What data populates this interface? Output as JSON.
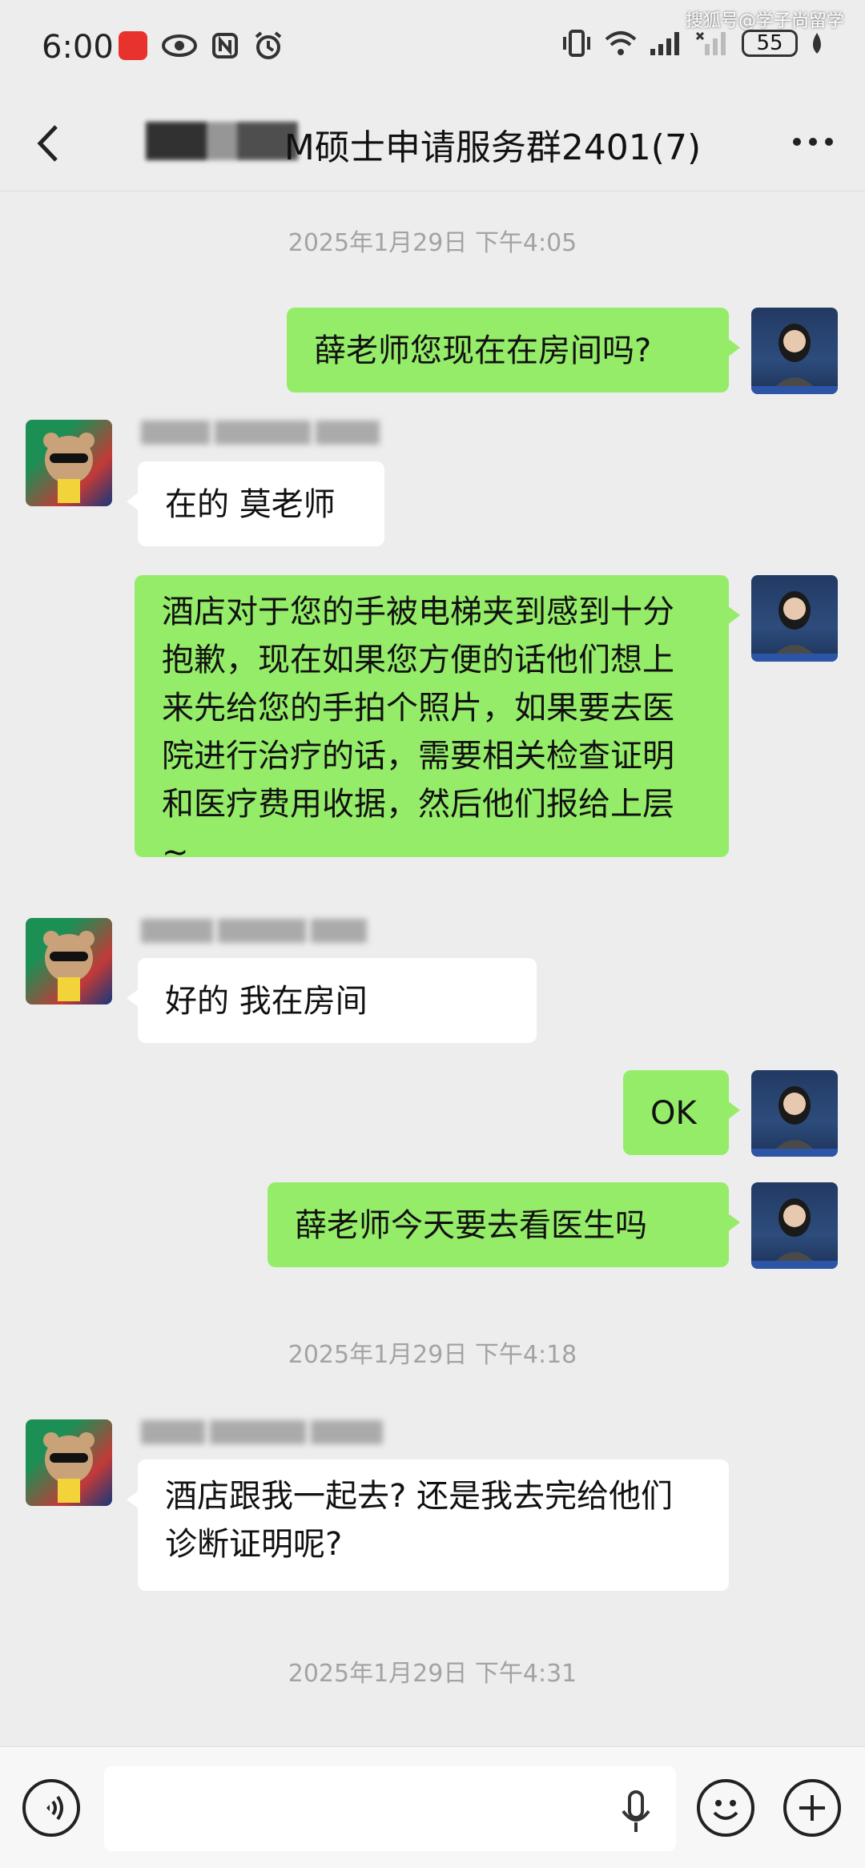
{
  "status": {
    "time": "6:00",
    "battery": "55",
    "watermark": "搜狐号@学子尚留学"
  },
  "header": {
    "title": "M硕士申请服务群2401(7)",
    "back_icon": "chevron-left-icon",
    "more_icon": "more-horizontal-icon"
  },
  "chat": {
    "timestamps": [
      "2025年1月29日 下午4:05",
      "2025年1月29日 下午4:18",
      "2025年1月29日 下午4:31"
    ],
    "messages": [
      {
        "from": "me",
        "text": "薛老师您现在在房间吗?"
      },
      {
        "from": "other",
        "text": "在的 莫老师"
      },
      {
        "from": "me",
        "text": "酒店对于您的手被电梯夹到感到十分抱歉，现在如果您方便的话他们想上来先给您的手拍个照片，如果要去医院进行治疗的话，需要相关检查证明和医疗费用收据，然后他们报给上层 ~"
      },
      {
        "from": "other",
        "text": "好的  我在房间"
      },
      {
        "from": "me",
        "text": "OK"
      },
      {
        "from": "me",
        "text": "薛老师今天要去看医生吗"
      },
      {
        "from": "other",
        "text": "酒店跟我一起去? 还是我去完给他们诊断证明呢?"
      }
    ]
  },
  "inputbar": {
    "placeholder": "",
    "voice_icon": "voice-mode-icon",
    "mic_icon": "microphone-icon",
    "emoji_icon": "emoji-icon",
    "plus_icon": "plus-icon"
  }
}
